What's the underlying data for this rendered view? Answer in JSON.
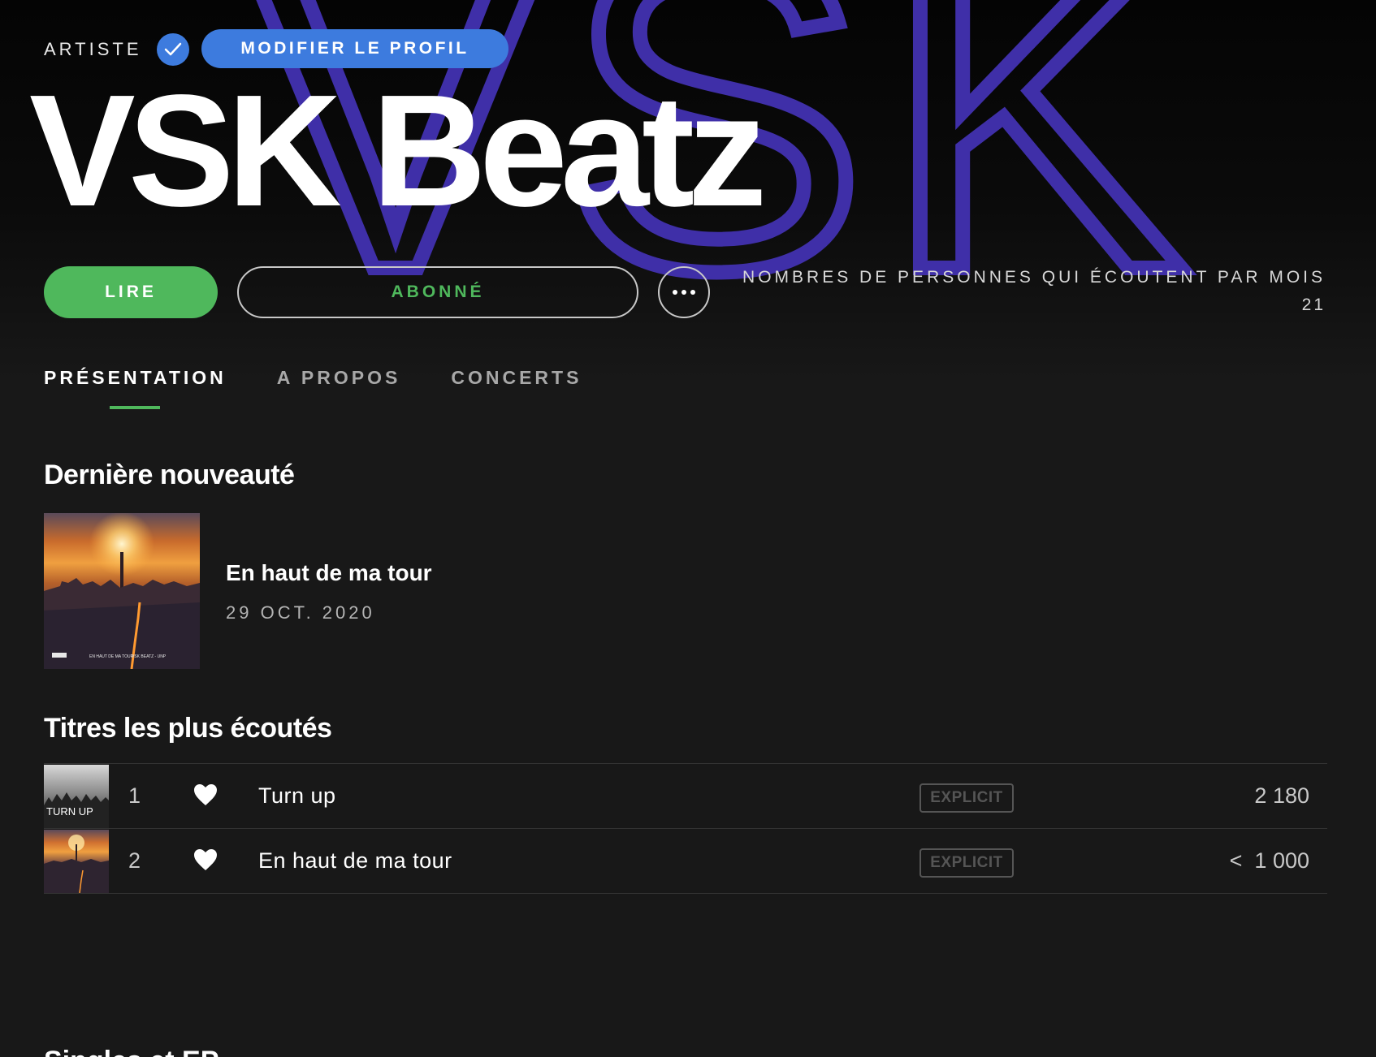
{
  "header": {
    "artist_label": "ARTISTE",
    "edit_profile_label": "MODIFIER LE PROFIL",
    "artist_name": "VSK Beatz",
    "background_logo_text": "VSK",
    "play_label": "LIRE",
    "follow_label": "ABONNÉ",
    "monthly_listeners_label": "NOMBRES DE PERSONNES QUI ÉCOUTENT PAR MOIS",
    "monthly_listeners_value": "21"
  },
  "tabs": [
    {
      "label": "PRÉSENTATION",
      "active": true
    },
    {
      "label": "A PROPOS",
      "active": false
    },
    {
      "label": "CONCERTS",
      "active": false
    }
  ],
  "latest_release": {
    "section_title": "Dernière nouveauté",
    "title": "En haut de ma tour",
    "date": "29 OCT. 2020",
    "cover_caption_left": "EN HAUT DE MA TOUR",
    "cover_caption_right": "VSK BEATZ - UNP"
  },
  "top_tracks": {
    "section_title": "Titres les plus écoutés",
    "tracks": [
      {
        "number": "1",
        "title": "Turn up",
        "badge": "EXPLICIT",
        "plays": "2 180",
        "cover_text": "TURN UP"
      },
      {
        "number": "2",
        "title": "En haut de ma tour",
        "badge": "EXPLICIT",
        "plays": "<  1 000"
      }
    ]
  },
  "next_section": {
    "title": "Singles et EP"
  },
  "colors": {
    "accent_green": "#4fb85c",
    "accent_blue": "#3d7bde",
    "background": "#181818",
    "logo_purple": "#3f2fa8"
  },
  "icons": {
    "verified": "check-icon",
    "more": "more-horizontal-icon",
    "like": "heart-icon"
  }
}
